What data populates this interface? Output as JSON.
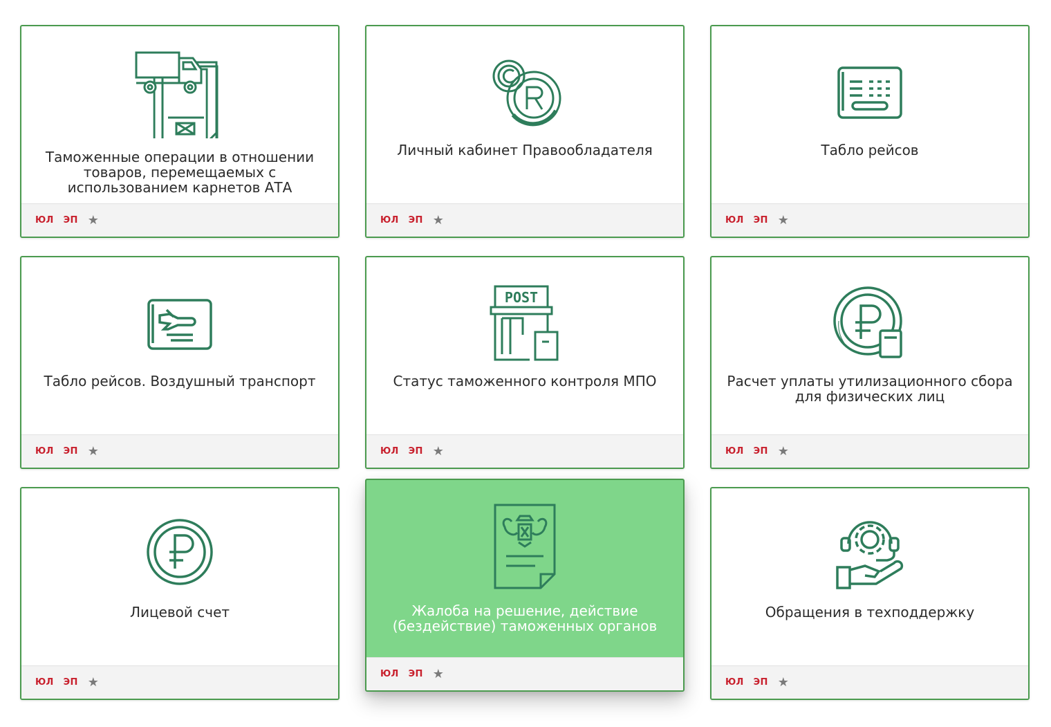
{
  "palette": {
    "border": "#4a9a4e",
    "icon": "#2e7d5b",
    "active_bg": "#7fd68a",
    "badge": "#c8202d",
    "footer_bg": "#f3f3f3"
  },
  "cards": [
    {
      "title": "Таможенные операции в отношении товаров, перемещаемых с использованием карнетов АТА",
      "icon": "truck-document-icon",
      "badges": [
        "ЮЛ",
        "ЭП"
      ],
      "active": false
    },
    {
      "title": "Личный кабинет Правообладателя",
      "icon": "copyright-trademark-icon",
      "badges": [
        "ЮЛ",
        "ЭП"
      ],
      "active": false
    },
    {
      "title": "Табло рейсов",
      "icon": "flight-board-icon",
      "badges": [
        "ЮЛ",
        "ЭП"
      ],
      "active": false
    },
    {
      "title": "Табло рейсов. Воздушный транспорт",
      "icon": "airplane-board-icon",
      "badges": [
        "ЮЛ",
        "ЭП"
      ],
      "active": false
    },
    {
      "title": "Статус таможенного контроля МПО",
      "icon": "post-office-icon",
      "badges": [
        "ЮЛ",
        "ЭП"
      ],
      "active": false
    },
    {
      "title": "Расчет уплаты утилизационного сбора для физических лиц",
      "icon": "ruble-calculator-icon",
      "badges": [
        "ЮЛ",
        "ЭП"
      ],
      "active": false
    },
    {
      "title": "Лицевой счет",
      "icon": "ruble-coin-icon",
      "badges": [
        "ЮЛ",
        "ЭП"
      ],
      "active": false
    },
    {
      "title": "Жалоба на решение, действие (бездействие) таможенных органов",
      "icon": "complaint-document-icon",
      "badges": [
        "ЮЛ",
        "ЭП"
      ],
      "active": true
    },
    {
      "title": "Обращения в техподдержку",
      "icon": "support-gear-icon",
      "badges": [
        "ЮЛ",
        "ЭП"
      ],
      "active": false
    }
  ],
  "favorite_icon": "star-icon"
}
